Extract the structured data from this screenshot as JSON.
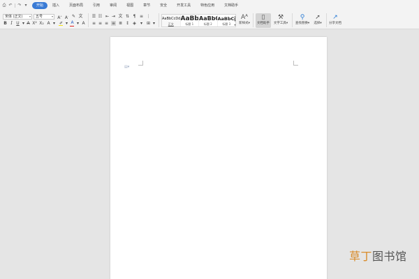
{
  "quick_access": {
    "icons": [
      "save-icon",
      "undo-icon",
      "redo-icon",
      "print-icon"
    ]
  },
  "menu": {
    "tabs": [
      "开始",
      "插入",
      "页面布局",
      "引用",
      "审阅",
      "视图",
      "章节",
      "安全",
      "开发工具",
      "特色应用",
      "文档助手"
    ],
    "active_tab": "开始"
  },
  "ribbon": {
    "font_name": "宋体 (正文)",
    "font_size": "五号",
    "styles": [
      {
        "sample": "AaBbCcDd",
        "label": "正文"
      },
      {
        "sample": "AaBb",
        "label": "标题 1"
      },
      {
        "sample": "AaBbC",
        "label": "标题 2"
      },
      {
        "sample": "AaBbCc",
        "label": "标题 3"
      }
    ],
    "new_style": "新样式",
    "doc_helper": "文档助手",
    "text_tools": "文字工具",
    "find_replace": "查找替换",
    "select": "选择",
    "share_doc": "分享文档"
  },
  "colors": {
    "accent": "#3a7bd5",
    "highlight": "#f5e30c",
    "font_color": "#e02020"
  },
  "watermark": {
    "part1": "草丁",
    "part2": "图书馆"
  }
}
